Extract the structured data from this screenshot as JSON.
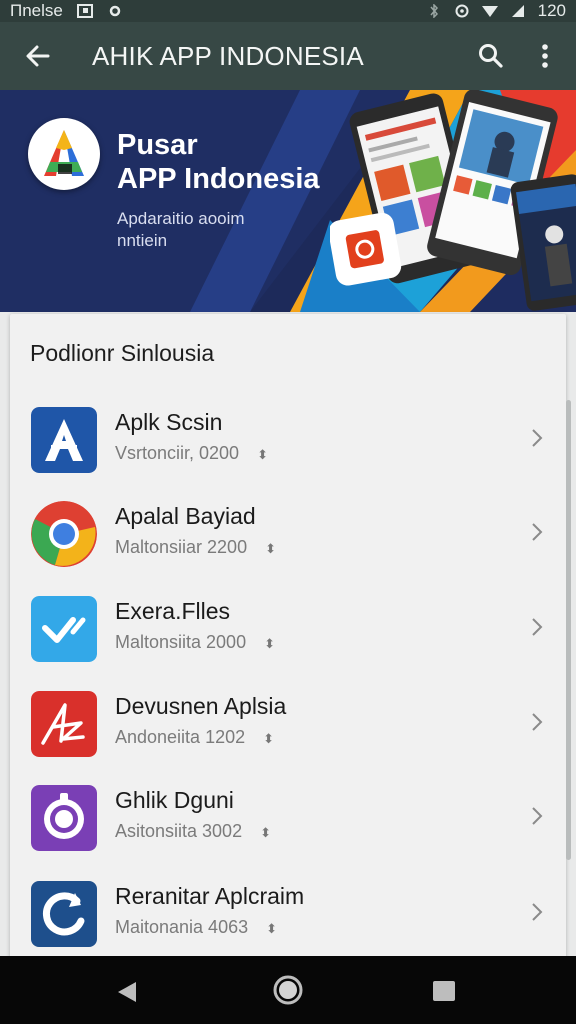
{
  "status_bar": {
    "left_text": "Пnelse",
    "time": "120",
    "icons": [
      "image-icon",
      "settings-icon",
      "bluetooth-icon",
      "alarm-icon",
      "wifi-icon",
      "signal-icon"
    ]
  },
  "app_bar": {
    "title": "AHIK  APP INDONESIA",
    "icons": [
      "back-arrow-icon",
      "search-icon",
      "more-vert-icon"
    ]
  },
  "banner": {
    "title_line1": "Pusar",
    "title_line2": "APP Indonesia",
    "subtitle": "Apdaraitio aooim nntiein",
    "colors": [
      "#1f2e63",
      "#f5a41a",
      "#1da1d8",
      "#e63b2e"
    ]
  },
  "list": {
    "section_title": "Podlionr Sinlousia",
    "items": [
      {
        "name": "Aplk Scsin",
        "meta": "Vsrtonciir,  0200",
        "icon": "a-letter-app-icon",
        "color": "#1f56a8"
      },
      {
        "name": "Apalal Bayiad",
        "meta": "Maltonsiiar  2200",
        "icon": "chrome-browser-icon",
        "color": "#de4032"
      },
      {
        "name": "Exera.Flles",
        "meta": "Maltonsiita  2000",
        "icon": "checkmark-app-icon",
        "color": "#33a8e8"
      },
      {
        "name": "Devusnen Aplsia",
        "meta": "Andoneiita  1202",
        "icon": "signature-app-icon",
        "color": "#d9302b"
      },
      {
        "name": "Ghlik Dguni",
        "meta": "Asitonsiita  3002",
        "icon": "camera-ring-icon",
        "color": "#7a3fb5"
      },
      {
        "name": "Reranitar Aplcraim",
        "meta": "Maitonania  4063",
        "icon": "refresh-app-icon",
        "color": "#1e4f8c"
      }
    ]
  },
  "nav_bar": {
    "icons": [
      "nav-back-icon",
      "nav-home-icon",
      "nav-recents-icon"
    ]
  }
}
